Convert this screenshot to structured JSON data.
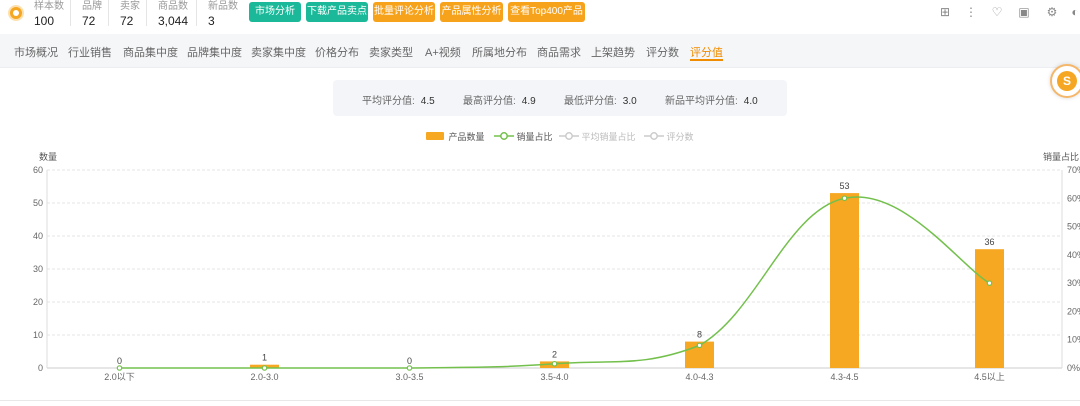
{
  "stats": [
    {
      "label": "样本数",
      "value": "100"
    },
    {
      "label": "品牌",
      "value": "72"
    },
    {
      "label": "卖家",
      "value": "72"
    },
    {
      "label": "商品数",
      "value": "3,044"
    },
    {
      "label": "新品数",
      "value": "3"
    }
  ],
  "buttons": [
    "市场分析",
    "下载产品卖点",
    "批量评论分析",
    "产品属性分析",
    "查看Top400产品"
  ],
  "tabs": [
    "市场概况",
    "行业销售",
    "商品集中度",
    "品牌集中度",
    "卖家集中度",
    "价格分布",
    "卖家类型",
    "A+视频",
    "所属地分布",
    "商品需求",
    "上架趋势",
    "评分数",
    "评分值"
  ],
  "active_tab": "评分值",
  "summary": [
    {
      "label": "平均评分值:",
      "value": "4.5"
    },
    {
      "label": "最高评分值:",
      "value": "4.9"
    },
    {
      "label": "最低评分值:",
      "value": "3.0"
    },
    {
      "label": "新品平均评分值:",
      "value": "4.0"
    }
  ],
  "colors": {
    "bar": "#f7a823",
    "line": "#73c04c",
    "accent": "#f08c00",
    "teal": "#1bb99a",
    "orange": "#f7a21b"
  },
  "chart_data": {
    "type": "bar",
    "categories": [
      "2.0以下",
      "2.0-3.0",
      "3.0-3.5",
      "3.5-4.0",
      "4.0-4.3",
      "4.3-4.5",
      "4.5以上"
    ],
    "series": [
      {
        "name": "产品数量",
        "type": "bar",
        "axis": "left",
        "values": [
          0,
          1,
          0,
          2,
          8,
          53,
          36
        ]
      },
      {
        "name": "销量占比",
        "type": "line",
        "axis": "right",
        "values": [
          0,
          0,
          0,
          1.5,
          8,
          60,
          30
        ]
      }
    ],
    "legend": [
      "产品数量",
      "销量占比",
      "平均销量占比",
      "评分数"
    ],
    "legend_inactive": [
      "平均销量占比",
      "评分数"
    ],
    "ylabel": "数量",
    "ylabel_right": "销量占比",
    "ylim": [
      0,
      60
    ],
    "yticks": [
      "0",
      "10",
      "20",
      "30",
      "40",
      "50",
      "60"
    ],
    "ylim_right": [
      0,
      70
    ],
    "yticks_right": [
      "0%",
      "10%",
      "20%",
      "30%",
      "40%",
      "50%",
      "60%",
      "70%"
    ],
    "legend_position": "top-center",
    "grid": true
  }
}
